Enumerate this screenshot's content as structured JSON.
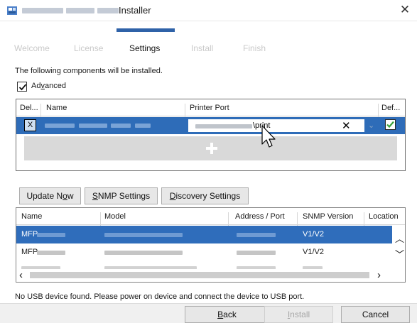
{
  "window": {
    "title": "Installer",
    "close_icon": "close-icon",
    "app_icon": "installer-app-icon"
  },
  "steps": [
    {
      "label": "Welcome",
      "state": "done"
    },
    {
      "label": "License",
      "state": "done"
    },
    {
      "label": "Settings",
      "state": "active"
    },
    {
      "label": "Install",
      "state": "pending"
    },
    {
      "label": "Finish",
      "state": "pending"
    }
  ],
  "info_text": "The following components will be installed.",
  "advanced": {
    "label_pre": "Ad",
    "label_hot": "v",
    "label_post": "anced",
    "checked": true
  },
  "port_table": {
    "columns": [
      "Del...",
      "Name",
      "Printer Port",
      "Def..."
    ],
    "row": {
      "delete_label": "X",
      "port_suffix": "\\print",
      "clear_label": "✕",
      "default_checked": true
    },
    "add_icon": "plus-icon"
  },
  "buttons": {
    "update_now": {
      "pre": "Update N",
      "hot": "o",
      "post": "w"
    },
    "snmp_settings": {
      "pre": "",
      "hot": "S",
      "post": "NMP Settings"
    },
    "discovery_settings": {
      "pre": "",
      "hot": "D",
      "post": "iscovery Settings"
    },
    "back": {
      "pre": "",
      "hot": "B",
      "post": "ack"
    },
    "install": {
      "pre": "",
      "hot": "I",
      "post": "nstall"
    },
    "cancel": "Cancel"
  },
  "mfp_table": {
    "columns": [
      "Name",
      "Model",
      "Address / Port",
      "SNMP Version",
      "Location"
    ],
    "rows": [
      {
        "name": "MFP",
        "snmp": "V1/V2",
        "selected": true
      },
      {
        "name": "MFP",
        "snmp": "V1/V2",
        "selected": false
      }
    ]
  },
  "status_text": "No USB device found. Please power on device and connect the device to USB port.",
  "colors": {
    "accent": "#2f62a8",
    "selection": "#2e6cb8",
    "disabled_text": "#a7a7a7"
  }
}
